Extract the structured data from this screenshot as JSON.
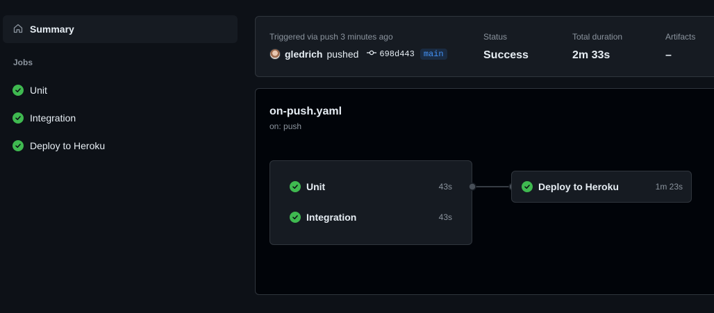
{
  "sidebar": {
    "summary_label": "Summary",
    "jobs_heading": "Jobs",
    "jobs": [
      {
        "label": "Unit",
        "status": "success"
      },
      {
        "label": "Integration",
        "status": "success"
      },
      {
        "label": "Deploy to Heroku",
        "status": "success"
      }
    ]
  },
  "run_summary": {
    "trigger_text": "Triggered via push 3 minutes ago",
    "actor": "gledrich",
    "action": "pushed",
    "commit": "698d443",
    "branch": "main",
    "status_label": "Status",
    "status_value": "Success",
    "duration_label": "Total duration",
    "duration_value": "2m 33s",
    "artifacts_label": "Artifacts",
    "artifacts_value": "–"
  },
  "workflow": {
    "file": "on-push.yaml",
    "trigger": "on: push",
    "group_jobs": [
      {
        "name": "Unit",
        "duration": "43s"
      },
      {
        "name": "Integration",
        "duration": "43s"
      }
    ],
    "deploy_job": {
      "name": "Deploy to Heroku",
      "duration": "1m 23s"
    }
  },
  "colors": {
    "success": "#3fb950",
    "background": "#0d1117",
    "link": "#4493f8"
  }
}
